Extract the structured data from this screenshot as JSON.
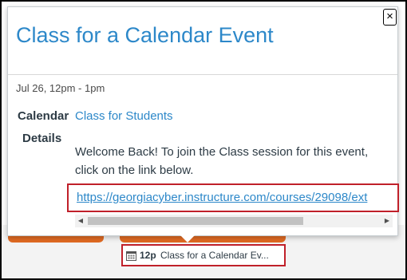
{
  "popover": {
    "title": "Class for a Calendar Event",
    "close_label": "×",
    "date": "Jul 26, 12pm - 1pm",
    "calendar_label": "Calendar",
    "calendar_value": "Class for Students",
    "details_label": "Details",
    "details_text": "Welcome Back! To join the Class session for this event, click on the link below.",
    "details_link": "https://georgiacyber.instructure.com/courses/29098/ext",
    "scroll_left": "◀",
    "scroll_right": "▶"
  },
  "event_chip": {
    "time": "12p",
    "title": "Class for a Calendar Ev...",
    "icon": "calendar-icon"
  },
  "colors": {
    "title": "#2d88c9",
    "link": "#2d88c9",
    "highlight_border": "#c0202a",
    "accent_orange": "#e06a22"
  }
}
